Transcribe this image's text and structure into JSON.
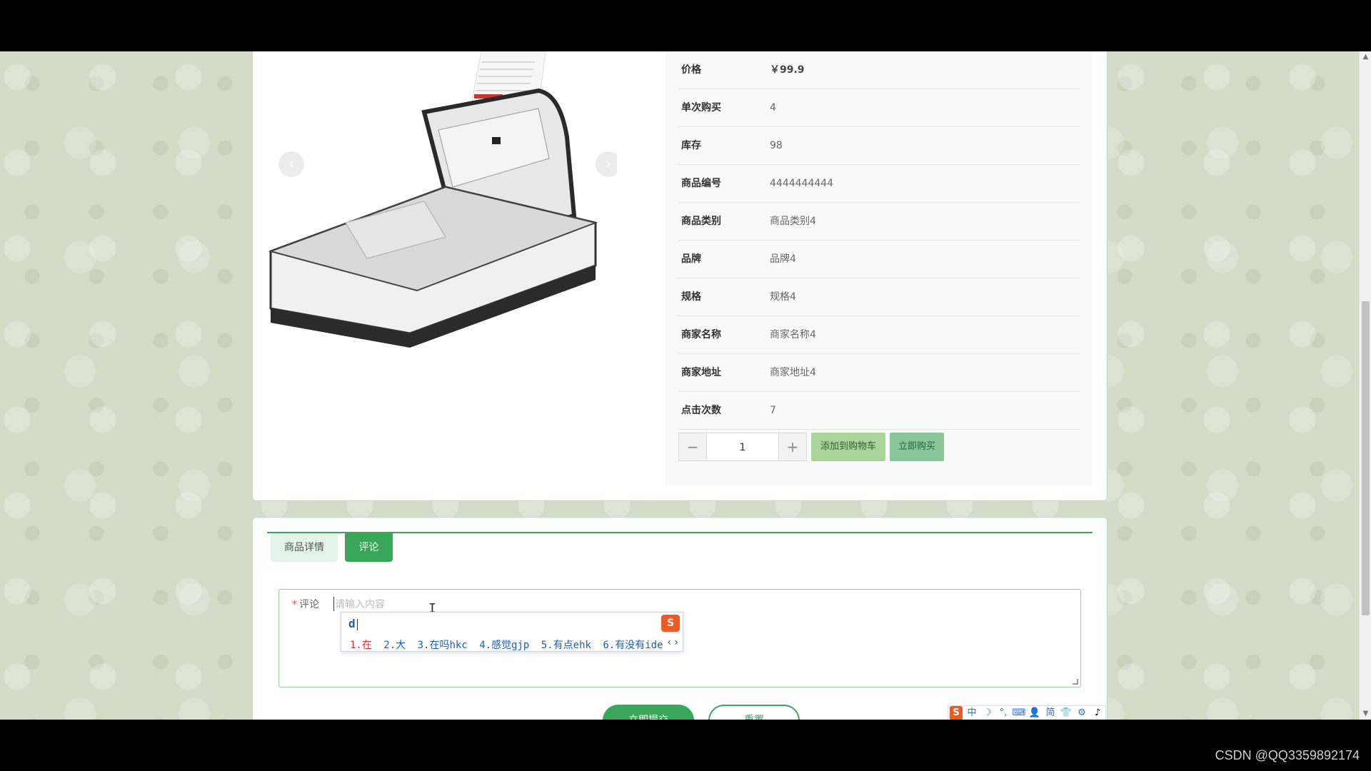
{
  "product_info": {
    "rows": [
      {
        "key": "价格",
        "value": "￥99.9"
      },
      {
        "key": "单次购买",
        "value": "4"
      },
      {
        "key": "库存",
        "value": "98"
      },
      {
        "key": "商品编号",
        "value": "4444444444"
      },
      {
        "key": "商品类别",
        "value": "商品类别4"
      },
      {
        "key": "品牌",
        "value": "品牌4"
      },
      {
        "key": "规格",
        "value": "规格4"
      },
      {
        "key": "商家名称",
        "value": "商家名称4"
      },
      {
        "key": "商家地址",
        "value": "商家地址4"
      },
      {
        "key": "点击次数",
        "value": "7"
      }
    ]
  },
  "purchase": {
    "minus": "−",
    "quantity": "1",
    "plus": "+",
    "add_to_cart": "添加到购物车",
    "buy_now": "立即购买"
  },
  "carousel": {
    "prev": "‹",
    "next": "›"
  },
  "tabs": {
    "details": "商品详情",
    "comment": "评论"
  },
  "comment_form": {
    "required_mark": "*",
    "label": "评论",
    "placeholder": "请输入内容",
    "submit": "立即提交",
    "reset": "重置"
  },
  "ime": {
    "typed": "d",
    "logo": "S",
    "candidates": [
      "1.在",
      "2.大",
      "3.在吗hkc",
      "4.感觉gjp",
      "5.有点ehk",
      "6.有没有ide"
    ],
    "next": "‹ ›"
  },
  "ime_toolbar": {
    "items": [
      "S",
      "中",
      "☽",
      "°,",
      "⌨",
      "👤",
      "简",
      "👕",
      "⚙",
      "♪"
    ]
  },
  "watermark": "CSDN @QQ3359892174",
  "colors": {
    "accent": "#3aa65a",
    "accent_light": "#e4f3e7",
    "cart_btn": "#a9d49a",
    "buy_btn": "#89c79a"
  }
}
